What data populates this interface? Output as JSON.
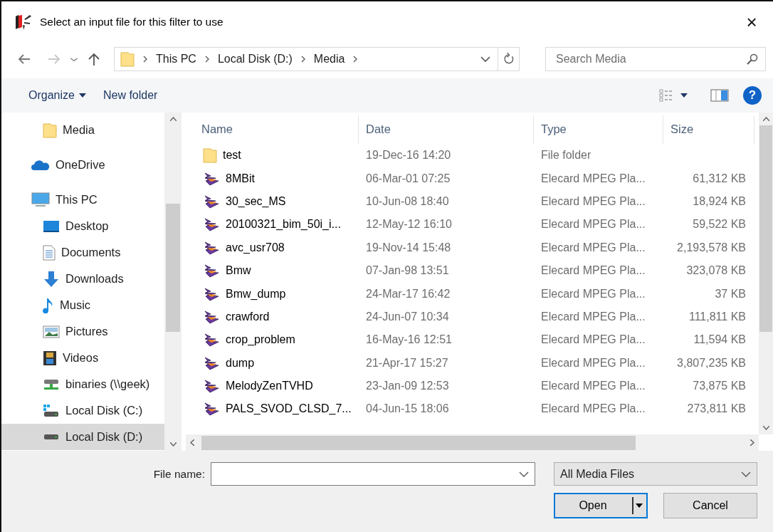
{
  "window": {
    "title": "Select an input file for this filter to use",
    "close": "×"
  },
  "address": {
    "crumbs": [
      "This PC",
      "Local Disk (D:)",
      "Media"
    ],
    "search_placeholder": "Search Media"
  },
  "commands": {
    "organize": "Organize",
    "new_folder": "New folder",
    "help": "?"
  },
  "nav": {
    "scrolled_group_children": [
      {
        "label": "Media",
        "kind": "folder",
        "selected": false
      }
    ],
    "items": [
      {
        "label": "OneDrive",
        "kind": "cloud",
        "selected": false
      },
      {
        "label": "This PC",
        "kind": "computer",
        "selected": false,
        "children": [
          {
            "label": "Desktop",
            "kind": "desktop",
            "selected": false
          },
          {
            "label": "Documents",
            "kind": "documents",
            "selected": false
          },
          {
            "label": "Downloads",
            "kind": "downloads",
            "selected": false
          },
          {
            "label": "Music",
            "kind": "music",
            "selected": false
          },
          {
            "label": "Pictures",
            "kind": "pictures",
            "selected": false
          },
          {
            "label": "Videos",
            "kind": "videos",
            "selected": false
          },
          {
            "label": "binaries (\\\\geek)",
            "kind": "network-drive",
            "selected": false
          },
          {
            "label": "Local Disk (C:)",
            "kind": "system-drive",
            "selected": false
          },
          {
            "label": "Local Disk (D:)",
            "kind": "drive",
            "selected": true
          }
        ]
      }
    ]
  },
  "table": {
    "columns": [
      "Name",
      "Date",
      "Type",
      "Size"
    ],
    "rows": [
      {
        "kind": "folder",
        "name": "test",
        "date": "19-Dec-16 14:20",
        "type": "File folder"
      },
      {
        "kind": "video",
        "name": "8MBit",
        "date": "06-Mar-01 07:25",
        "type": "Elecard MPEG Pla...",
        "size": "61,312 KB"
      },
      {
        "kind": "video",
        "name": "30_sec_MS",
        "date": "10-Jun-08 18:40",
        "type": "Elecard MPEG Pla...",
        "size": "18,924 KB"
      },
      {
        "kind": "video",
        "name": "20100321_bim_50i_i...",
        "date": "12-May-12 16:10",
        "type": "Elecard MPEG Pla...",
        "size": "59,522 KB"
      },
      {
        "kind": "video",
        "name": "avc_usr708",
        "date": "19-Nov-14 15:48",
        "type": "Elecard MPEG Pla...",
        "size": "2,193,578 KB"
      },
      {
        "kind": "video",
        "name": "Bmw",
        "date": "07-Jan-98 13:51",
        "type": "Elecard MPEG Pla...",
        "size": "323,078 KB"
      },
      {
        "kind": "video",
        "name": "Bmw_dump",
        "date": "24-Mar-17 16:42",
        "type": "Elecard MPEG Pla...",
        "size": "37 KB"
      },
      {
        "kind": "video",
        "name": "crawford",
        "date": "24-Jun-07 10:34",
        "type": "Elecard MPEG Pla...",
        "size": "111,811 KB"
      },
      {
        "kind": "video",
        "name": "crop_problem",
        "date": "16-May-16 12:51",
        "type": "Elecard MPEG Pla...",
        "size": "11,594 KB"
      },
      {
        "kind": "video",
        "name": "dump",
        "date": "21-Apr-17 15:27",
        "type": "Elecard MPEG Pla...",
        "size": "3,807,235 KB"
      },
      {
        "kind": "video",
        "name": "MelodyZenTVHD",
        "date": "23-Jan-09 12:53",
        "type": "Elecard MPEG Pla...",
        "size": "73,875 KB"
      },
      {
        "kind": "video",
        "name": "PALS_SVOD_CLSD_7...",
        "date": "04-Jun-15 18:06",
        "type": "Elecard MPEG Pla...",
        "size": "273,811 KB"
      }
    ]
  },
  "footer": {
    "file_name_label": "File name:",
    "filter": "All Media Files",
    "open": "Open",
    "cancel": "Cancel"
  }
}
